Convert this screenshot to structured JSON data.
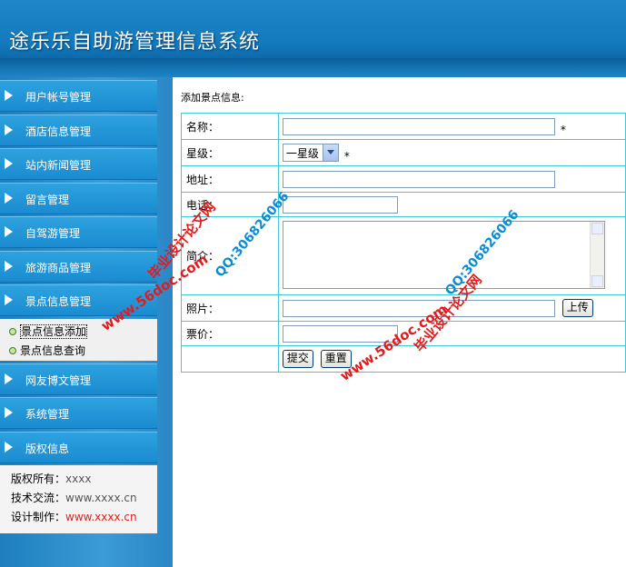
{
  "header": {
    "title": "途乐乐自助游管理信息系统"
  },
  "sidebar": {
    "menu_top": [
      {
        "label": "用户帐号管理"
      },
      {
        "label": "酒店信息管理"
      },
      {
        "label": "站内新闻管理"
      },
      {
        "label": "留言管理"
      },
      {
        "label": "自驾游管理"
      },
      {
        "label": "旅游商品管理"
      },
      {
        "label": "景点信息管理"
      }
    ],
    "submenu": [
      {
        "label": "景点信息添加"
      },
      {
        "label": "景点信息查询"
      }
    ],
    "menu_bottom": [
      {
        "label": "网友博文管理"
      },
      {
        "label": "系统管理"
      },
      {
        "label": "版权信息"
      }
    ],
    "info": [
      {
        "label": "版权所有：",
        "value": "xxxx"
      },
      {
        "label": "技术交流：",
        "value": "www.xxxx.cn"
      },
      {
        "label": "设计制作：",
        "value": "www.xxxx.cn"
      }
    ]
  },
  "main": {
    "title": "添加景点信息:",
    "fields": {
      "name_label": "名称：",
      "star_label": "星级：",
      "star_value": "一星级",
      "address_label": "地址：",
      "phone_label": "电话：",
      "intro_label": "简介：",
      "photo_label": "照片：",
      "price_label": "票价：",
      "required_mark": "*"
    },
    "buttons": {
      "upload": "上传",
      "submit": "提交",
      "reset": "重置"
    }
  },
  "watermark": {
    "site": "www.56doc.com",
    "name": "毕业设计论文网",
    "qq": "QQ:306826066"
  },
  "colors": {
    "header": "#137bbd",
    "menu": "#1a8bd0",
    "table_border": "#41c7d6",
    "accent_red": "#e0201c"
  }
}
